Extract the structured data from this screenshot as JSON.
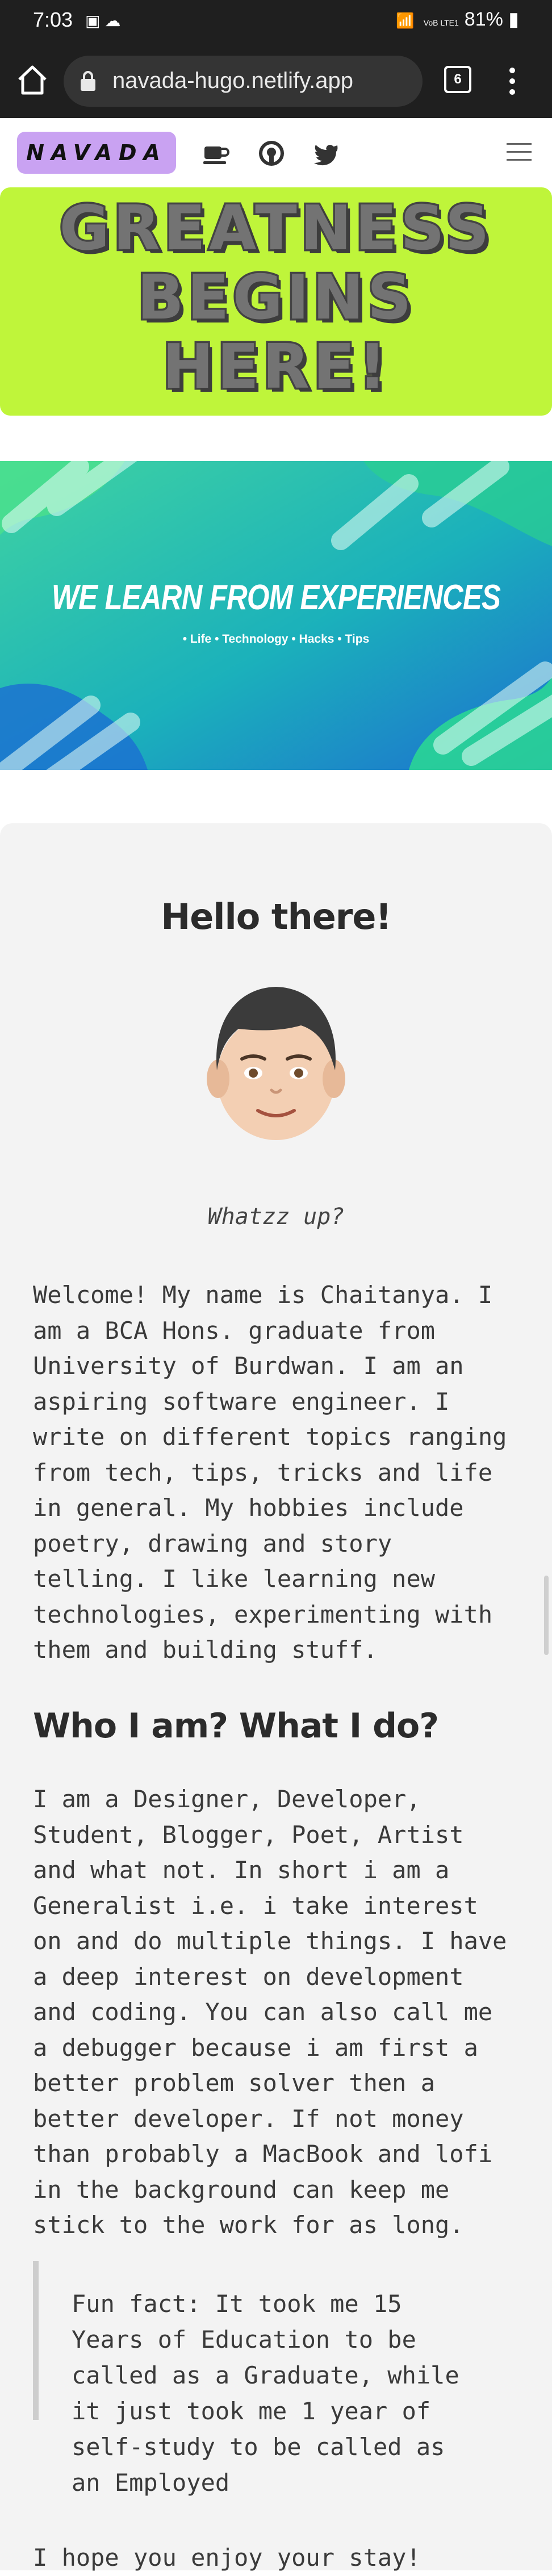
{
  "status_bar": {
    "time": "7:03",
    "notification_icons": [
      "gallery-icon",
      "weather-icon"
    ],
    "network": "VoB LTE1",
    "battery": "81%"
  },
  "browser": {
    "url": "navada-hugo.netlify.app",
    "tab_count": "6"
  },
  "site": {
    "logo": "NAVADA",
    "nav_icons": [
      "coffee-icon",
      "github-icon",
      "twitter-icon"
    ],
    "hero_lines": [
      "GREATNESS",
      "BEGINS",
      "HERE!"
    ],
    "hero_color": "#bff53a",
    "logo_color": "#c9a2f2"
  },
  "cover": {
    "title": "WE LEARN FROM EXPERIENCES",
    "subtitle": "• Life • Technology • Hacks • Tips"
  },
  "article": {
    "greeting": "Hello there!",
    "tagline": "Whatzz up?",
    "intro_lines": [
      "Welcome! My name is Chaitanya. I",
      "am a BCA Hons. graduate from",
      "University of Burdwan. I am an",
      "aspiring software engineer. I",
      "write on different topics ranging",
      "from tech, tips, tricks and life",
      "in general. My hobbies include",
      "poetry, drawing and story",
      "telling. I like learning new",
      "technologies, experimenting with",
      "them and building stuff."
    ],
    "section_heading": "Who I am? What I do?",
    "section_lines": [
      "I am a Designer, Developer,",
      "Student, Blogger, Poet, Artist",
      "and what not. In short i am a",
      "Generalist i.e. i take interest",
      "on and do multiple things. I have",
      "a deep interest on development",
      "and coding. You can also call me",
      "a debugger because i am first a",
      "better problem solver then a",
      "better developer. If not money",
      "than probably a MacBook and lofi",
      "in the background can keep me",
      "stick to the work for as long."
    ],
    "quote_lines": [
      "Fun fact: It took me 15",
      "Years of Education to be",
      "called as a Graduate, while",
      "it just took me 1 year of",
      "self-study to be called as",
      "an Employed"
    ],
    "closing_line": "I hope you enjoy your stay!"
  }
}
